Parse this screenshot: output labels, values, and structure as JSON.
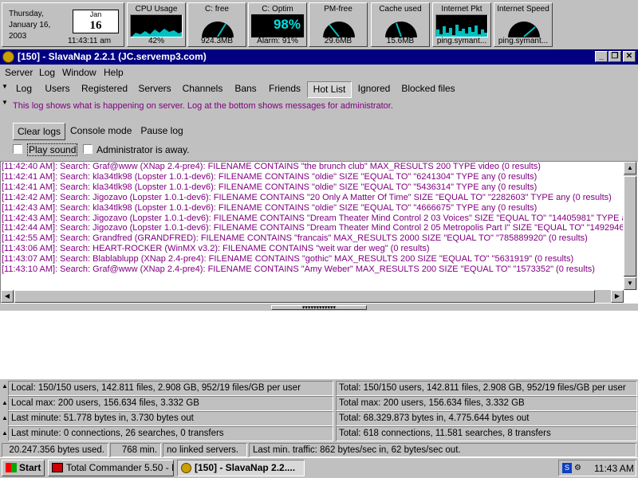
{
  "monitors": {
    "clock": {
      "day": "Thursday,",
      "date": "January 16,",
      "year": "2003",
      "month": "Jan",
      "daynum": "16",
      "time": "11:43:11 am"
    },
    "cpu": {
      "title": "CPU Usage",
      "value": "42%"
    },
    "c_free": {
      "title": "C: free",
      "value": "924.3MB"
    },
    "c_optim": {
      "title": "C: Optim",
      "percent": "98%",
      "alarm": "Alarm: 91%"
    },
    "pm_free": {
      "title": "PM-free",
      "value": "29.6MB"
    },
    "cache": {
      "title": "Cache used",
      "value": "15.6MB"
    },
    "internet_pkt": {
      "title": "Internet Pkt",
      "value": "ping.symant..."
    },
    "internet_speed": {
      "title": "Internet Speed",
      "value": "ping.symant..."
    }
  },
  "window": {
    "title": "[150] - SlavaNap 2.2.1 (JC.servemp3.com)",
    "minimize": "_",
    "restore": "❐",
    "close": "✕"
  },
  "menu": [
    "Server",
    "Log",
    "Window",
    "Help"
  ],
  "tabs": [
    "Log",
    "Users",
    "Registered",
    "Servers",
    "Channels",
    "Bans",
    "Friends",
    "Hot List",
    "Ignored",
    "Blocked files"
  ],
  "active_tab": "Hot List",
  "info_line": "This log shows what is happening on server. Log at the bottom shows messages for administrator.",
  "buttons": {
    "clear_logs": "Clear logs",
    "console_mode": "Console mode",
    "pause_log": "Pause log"
  },
  "checkboxes": {
    "play_sound": "Play sound",
    "admin_away": "Administrator is away."
  },
  "log": [
    "[11:42:40 AM]: Search: Graf@www (XNap 2.4-pre4): FILENAME CONTAINS \"the brunch club\" MAX_RESULTS 200 TYPE video (0 results)",
    "[11:42:41 AM]: Search: kla34tlk98 (Lopster 1.0.1-dev6): FILENAME CONTAINS \"oldie\" SIZE \"EQUAL TO\" \"6241304\" TYPE any (0 results)",
    "[11:42:41 AM]: Search: kla34tlk98 (Lopster 1.0.1-dev6): FILENAME CONTAINS \"oldie\" SIZE \"EQUAL TO\" \"5436314\" TYPE any (0 results)",
    "[11:42:42 AM]: Search: Jigozavo (Lopster 1.0.1-dev6): FILENAME CONTAINS \"20 Only A Matter Of Time\" SIZE \"EQUAL TO\" \"2282603\" TYPE any (0 results)",
    "[11:42:43 AM]: Search: kla34tlk98 (Lopster 1.0.1-dev6): FILENAME CONTAINS \"oldie\" SIZE \"EQUAL TO\" \"4666675\" TYPE any (0 results)",
    "[11:42:43 AM]: Search: Jigozavo (Lopster 1.0.1-dev6): FILENAME CONTAINS \"Dream Theater Mind Control 2 03 Voices\" SIZE \"EQUAL TO\" \"14405981\" TYPE any (0",
    "[11:42:44 AM]: Search: Jigozavo (Lopster 1.0.1-dev6): FILENAME CONTAINS \"Dream Theater Mind Control 2 05 Metropolis Part I\" SIZE \"EQUAL TO\" \"14929460\" T",
    "[11:42:55 AM]: Search: Grandfred (GRANDFRED): FILENAME CONTAINS \"francais\" MAX_RESULTS 2000 SIZE \"EQUAL TO\" \"785889920\" (0 results)",
    "[11:43:06 AM]: Search: HEART-ROCKER (WinMX v3.2): FILENAME CONTAINS \"weit war der weg\" (0 results)",
    "[11:43:07 AM]: Search: Blablablupp (XNap 2.4-pre4): FILENAME CONTAINS \"gothic\" MAX_RESULTS 200 SIZE \"EQUAL TO\" \"5631919\" (0 results)",
    "[11:43:10 AM]: Search: Graf@www (XNap 2.4-pre4): FILENAME CONTAINS \"Amy Weber\" MAX_RESULTS 200 SIZE \"EQUAL TO\" \"1573352\" (0 results)"
  ],
  "stats": {
    "left": [
      "Local: 150/150 users, 142.811 files, 2.908 GB, 952/19 files/GB per user",
      "Local max: 200 users, 156.634 files, 3.332 GB",
      "Last minute: 51.778 bytes in, 3.730 bytes out",
      "Last minute: 0 connections, 26 searches, 0 transfers"
    ],
    "right": [
      "Total: 150/150 users, 142.811 files, 2.908 GB, 952/19 files/GB per user",
      "Total max: 200 users, 156.634 files, 3.332 GB",
      "Total: 68.329.873 bytes in, 4.775.644 bytes out",
      "Total: 618 connections, 11.581 searches, 8 transfers"
    ]
  },
  "status": {
    "bytes_used": "20.247.356 bytes used.",
    "minutes": "768 min.",
    "linked": "no linked servers.",
    "traffic": "Last min. traffic: 862 bytes/sec in, 62 bytes/sec out."
  },
  "taskbar": {
    "start": "Start",
    "tasks": [
      "Total Commander 5.50 - N...",
      "[150] - SlavaNap 2.2...."
    ],
    "time": "11:43 AM"
  },
  "colors": {
    "title_bar": "#000080",
    "log_text": "#800080",
    "desktop_gray": "#c0c0c0",
    "meter_cyan": "#00c0c0"
  }
}
